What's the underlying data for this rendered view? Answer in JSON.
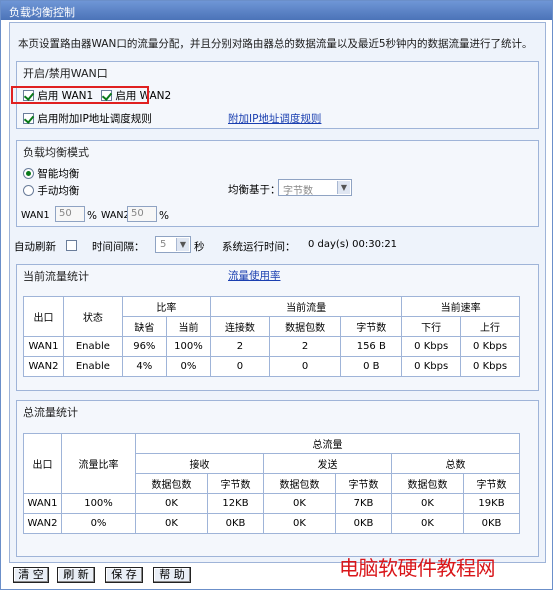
{
  "window": {
    "title": "负载均衡控制"
  },
  "intro": "本页设置路由器WAN口的流量分配，并且分别对路由器总的数据流量以及最近5秒钟内的数据流量进行了统计。",
  "wan_section": {
    "title": "开启/禁用WAN口",
    "enable_wan1": {
      "label": "启用 WAN1",
      "checked": true
    },
    "enable_wan2": {
      "label": "启用 WAN2",
      "checked": true
    },
    "enable_extra_ip_rule": {
      "label": "启用附加IP地址调度规则",
      "checked": true
    },
    "extra_ip_rule_link": "附加IP地址调度规则"
  },
  "balance_mode": {
    "title": "负载均衡模式",
    "smart": {
      "label": "智能均衡",
      "selected": true
    },
    "manual": {
      "label": "手动均衡",
      "selected": false
    },
    "based_on_label": "均衡基于：",
    "based_on_value": "字节数",
    "wan1_label": "WAN1",
    "wan1_value": "50",
    "wan2_label": "WAN2",
    "wan2_value": "50",
    "percent": "%"
  },
  "refresh": {
    "auto_label": "自动刷新",
    "interval_label": "时间间隔：",
    "interval_value": "5",
    "unit": "秒",
    "uptime_label": "系统运行时间：",
    "uptime_value": "0 day(s) 00:30:21"
  },
  "current_stats": {
    "title": "当前流量统计",
    "usage_link": "流量使用率",
    "headers": {
      "port": "出口",
      "status": "状态",
      "ratio": "比率",
      "current_traffic": "当前流量",
      "current_rate": "当前速率",
      "default": "缺省",
      "current": "当前",
      "connections": "连接数",
      "packets": "数据包数",
      "bytes": "字节数",
      "down": "下行",
      "up": "上行"
    },
    "rows": [
      {
        "port": "WAN1",
        "status": "Enable",
        "default": "96%",
        "current": "100%",
        "connections": "2",
        "packets": "2",
        "bytes": "156 B",
        "down": "0 Kbps",
        "up": "0 Kbps"
      },
      {
        "port": "WAN2",
        "status": "Enable",
        "default": "4%",
        "current": "0%",
        "connections": "0",
        "packets": "0",
        "bytes": "0 B",
        "down": "0 Kbps",
        "up": "0 Kbps"
      }
    ]
  },
  "total_stats": {
    "title": "总流量统计",
    "headers": {
      "port": "出口",
      "ratio": "流量比率",
      "total": "总流量",
      "recv": "接收",
      "send": "发送",
      "sum": "总数",
      "packets": "数据包数",
      "bytes": "字节数"
    },
    "rows": [
      {
        "port": "WAN1",
        "ratio": "100%",
        "recv_packets": "0K",
        "recv_bytes": "12KB",
        "send_packets": "0K",
        "send_bytes": "7KB",
        "sum_packets": "0K",
        "sum_bytes": "19KB"
      },
      {
        "port": "WAN2",
        "ratio": "0%",
        "recv_packets": "0K",
        "recv_bytes": "0KB",
        "send_packets": "0K",
        "send_bytes": "0KB",
        "sum_packets": "0K",
        "sum_bytes": "0KB"
      }
    ]
  },
  "buttons": {
    "clear": "清 空",
    "refresh": "刷 新",
    "save": "保 存",
    "help": "帮 助"
  },
  "watermark": "电脑软硬件教程网",
  "colors": {
    "title_bar": "#5b83c6",
    "accent_red": "#e02020",
    "link": "#1a3fb0",
    "check_green": "#0a7a1a"
  }
}
